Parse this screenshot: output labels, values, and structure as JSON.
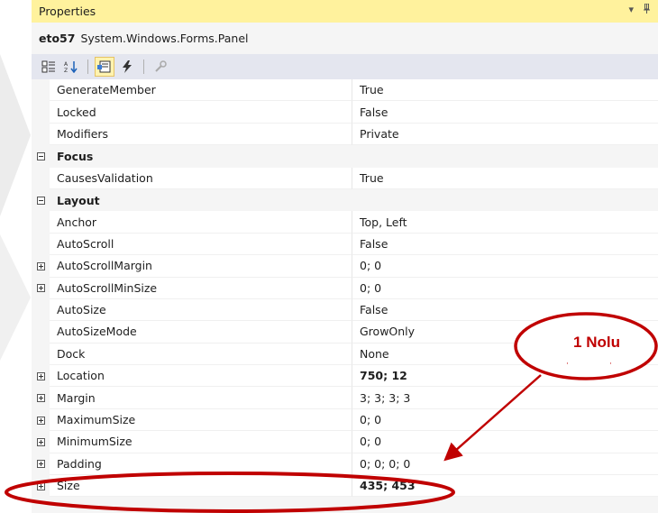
{
  "panel": {
    "title": "Properties",
    "pin_glyph": "▾ ⊥",
    "object_name": "eto57",
    "object_type": "System.Windows.Forms.Panel"
  },
  "toolbar": {
    "buttons": [
      {
        "icon": "categorized-icon",
        "active": false
      },
      {
        "icon": "alphabetical-icon",
        "active": false
      },
      {
        "icon": "properties-icon",
        "active": true
      },
      {
        "icon": "events-icon",
        "active": false
      },
      {
        "icon": "property-pages-icon",
        "active": false
      }
    ]
  },
  "rows": [
    {
      "type": "prop",
      "name": "GenerateMember",
      "value": "True"
    },
    {
      "type": "prop",
      "name": "Locked",
      "value": "False"
    },
    {
      "type": "prop",
      "name": "Modifiers",
      "value": "Private"
    },
    {
      "type": "cat",
      "name": "Focus"
    },
    {
      "type": "prop",
      "name": "CausesValidation",
      "value": "True"
    },
    {
      "type": "cat",
      "name": "Layout"
    },
    {
      "type": "prop",
      "name": "Anchor",
      "value": "Top, Left"
    },
    {
      "type": "prop",
      "name": "AutoScroll",
      "value": "False"
    },
    {
      "type": "prop",
      "name": "AutoScrollMargin",
      "value": "0; 0",
      "expandable": true
    },
    {
      "type": "prop",
      "name": "AutoScrollMinSize",
      "value": "0; 0",
      "expandable": true
    },
    {
      "type": "prop",
      "name": "AutoSize",
      "value": "False"
    },
    {
      "type": "prop",
      "name": "AutoSizeMode",
      "value": "GrowOnly"
    },
    {
      "type": "prop",
      "name": "Dock",
      "value": "None"
    },
    {
      "type": "prop",
      "name": "Location",
      "value": "750; 12",
      "expandable": true,
      "bold": true
    },
    {
      "type": "prop",
      "name": "Margin",
      "value": "3; 3; 3; 3",
      "expandable": true
    },
    {
      "type": "prop",
      "name": "MaximumSize",
      "value": "0; 0",
      "expandable": true
    },
    {
      "type": "prop",
      "name": "MinimumSize",
      "value": "0; 0",
      "expandable": true
    },
    {
      "type": "prop",
      "name": "Padding",
      "value": "0; 0; 0; 0",
      "expandable": true
    },
    {
      "type": "prop",
      "name": "Size",
      "value": "435; 453",
      "expandable": true,
      "bold": true
    }
  ],
  "annotation": {
    "text": "1 Nolu",
    "color": "#c00000"
  }
}
